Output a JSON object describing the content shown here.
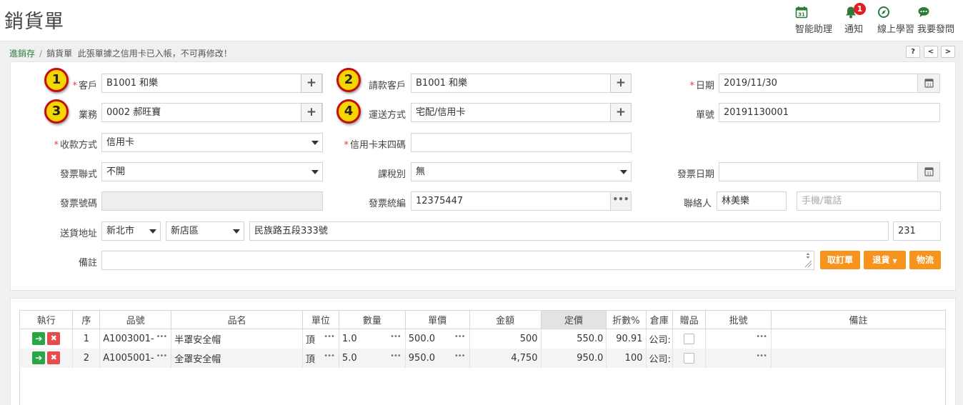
{
  "page": {
    "title": "銷貨單"
  },
  "toolbar": [
    {
      "label": "智能助理",
      "icon": "calendar-31-icon"
    },
    {
      "label": "通知",
      "icon": "bell-icon",
      "badge": "1"
    },
    {
      "label": "線上學習",
      "icon": "compass-icon"
    },
    {
      "label": "我要發問",
      "icon": "chat-bubble-icon"
    }
  ],
  "breadcrumb": {
    "root": "進銷存",
    "sep": "/",
    "current": "銷貨單",
    "message": "此張單據之信用卡已入帳，不可再修改！"
  },
  "nav": {
    "help": "?",
    "prev": "<",
    "next": ">"
  },
  "markers": [
    "1",
    "2",
    "3",
    "4"
  ],
  "form": {
    "customer": {
      "req": "*",
      "label": "客戶",
      "value": "B1001 和樂"
    },
    "billing_customer": {
      "label": "請款客戶",
      "value": "B1001 和樂"
    },
    "date": {
      "req": "*",
      "label": "日期",
      "value": "2019/11/30"
    },
    "salesperson": {
      "label": "業務",
      "value": "0002 郝旺寶"
    },
    "delivery_method": {
      "label": "運送方式",
      "value": "宅配/信用卡"
    },
    "order_no": {
      "label": "單號",
      "value": "20191130001"
    },
    "payment_method": {
      "req": "*",
      "label": "收款方式",
      "value": "信用卡"
    },
    "card_last4": {
      "req": "*",
      "label": "信用卡末四碼",
      "value": ""
    },
    "invoice_copies": {
      "label": "發票聯式",
      "value": "不開"
    },
    "tax_type": {
      "label": "課稅別",
      "value": "無"
    },
    "invoice_date": {
      "label": "發票日期",
      "value": ""
    },
    "invoice_no": {
      "label": "發票號碼",
      "value": ""
    },
    "tax_id": {
      "label": "發票統編",
      "value": "12375447"
    },
    "contact": {
      "label": "聯絡人",
      "value": "林美樂",
      "phone_placeholder": "手機/電話"
    },
    "address": {
      "label": "送貨地址",
      "city": "新北市",
      "district": "新店區",
      "street": "民族路五段333號",
      "zip": "231"
    },
    "note": {
      "label": "備註",
      "value": ""
    }
  },
  "buttons": {
    "fetch_order": "取訂單",
    "return": "退貨",
    "logistics": "物流",
    "add": "+",
    "dots": "•••"
  },
  "grid": {
    "headers": [
      "執行",
      "序",
      "品號",
      "品名",
      "單位",
      "數量",
      "單價",
      "金額",
      "定價",
      "折數%",
      "倉庫",
      "贈品",
      "批號",
      "備註"
    ],
    "rows": [
      {
        "seq": "1",
        "item_no": "A1003001-",
        "name": "半罩安全帽",
        "unit": "頂",
        "qty": "1.0",
        "price": "500.0",
        "amount": "500",
        "list_price": "550.0",
        "discount": "90.91",
        "warehouse": "公司:",
        "gift": false,
        "batch": "",
        "remark": ""
      },
      {
        "seq": "2",
        "item_no": "A1005001-",
        "name": "全罩安全帽",
        "unit": "頂",
        "qty": "5.0",
        "price": "950.0",
        "amount": "4,750",
        "list_price": "950.0",
        "discount": "100",
        "warehouse": "公司:",
        "gift": false,
        "batch": "",
        "remark": ""
      }
    ]
  },
  "colors": {
    "brand": "#2f7a3b",
    "orange": "#f7941d",
    "required": "#e53935",
    "go": "#27a745",
    "delete": "#e74c4c"
  }
}
